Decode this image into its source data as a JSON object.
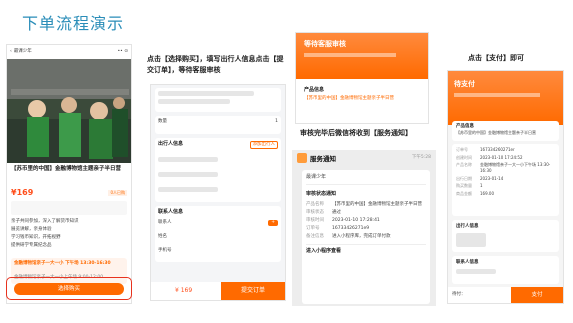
{
  "title": "下单流程演示",
  "captions": {
    "step1": "点击【选择购买】，填写出行人信息点击【提交订单】，等待客服审核",
    "step2": "审核完毕后微信将收到【服务通知】",
    "step3": "点击【支付】即可"
  },
  "phone1": {
    "back_label": "最课少年",
    "product_title": "【苏币里的中国】金融博物馆主题亲子半日营",
    "price": "¥169",
    "price_tag": "0人已购",
    "bullets": [
      "亲子共同参加，深入了解货币知识",
      "展览讲解，亲身体验",
      "学习钱币知识，开拓视野",
      "提供研学专属纪念品"
    ],
    "option_title": "金融博物馆亲子一大一小 下午场 13:30-16:30",
    "option_sub": "金融博物馆亲子一大一小上午场 9:00-12:00",
    "buy_button": "选择购买"
  },
  "phone2": {
    "qty_label": "数量",
    "qty_value": "1",
    "traveler_title": "出行人信息",
    "add_traveler": "添加出行人",
    "contact_title": "联系人信息",
    "contact_label": "联系人",
    "name_label": "姓名",
    "phone_label": "手机号",
    "total": "¥ 169",
    "submit": "提交订单"
  },
  "phone3": {
    "banner": "等待客服审核",
    "product_label": "产品信息",
    "product_name": "【苏币里的中国】金融博物馆主题亲子半日营"
  },
  "notify": {
    "service_title": "服务通知",
    "time": "下午5:28",
    "shop": "最课少年",
    "card_title": "审核状态通知",
    "rows": [
      {
        "k": "产品名称",
        "v": "【苏币里的中国】金融博物馆主题亲子半日营"
      },
      {
        "k": "审核状态",
        "v": "通过"
      },
      {
        "k": "审核时间",
        "v": "2023-01-10 17:28:41"
      },
      {
        "k": "订单号",
        "v": "16733426271e9"
      },
      {
        "k": "备注信息",
        "v": "进入小程序库，完成订单付款"
      }
    ],
    "link": "进入小程序查看"
  },
  "phone4": {
    "status": "待支付",
    "product_label": "产品信息",
    "product_name": "【苏币里的中国】金融博物馆主题亲子半日营",
    "order_rows": [
      {
        "k": "订单号",
        "v": "167334260271er"
      },
      {
        "k": "创建时间",
        "v": "2023-01-10 17:24:52"
      },
      {
        "k": "产品名称",
        "v": "金融博物馆亲子一大一小下午场 13:30-16:30"
      },
      {
        "k": "出行日期",
        "v": "2023-01-14"
      },
      {
        "k": "购买数量",
        "v": "1"
      },
      {
        "k": "商品金额",
        "v": "169.00"
      }
    ],
    "traveler_label": "出行人信息",
    "contact_label": "联系人信息",
    "pay_label": "待付：",
    "pay_button": "支付"
  }
}
